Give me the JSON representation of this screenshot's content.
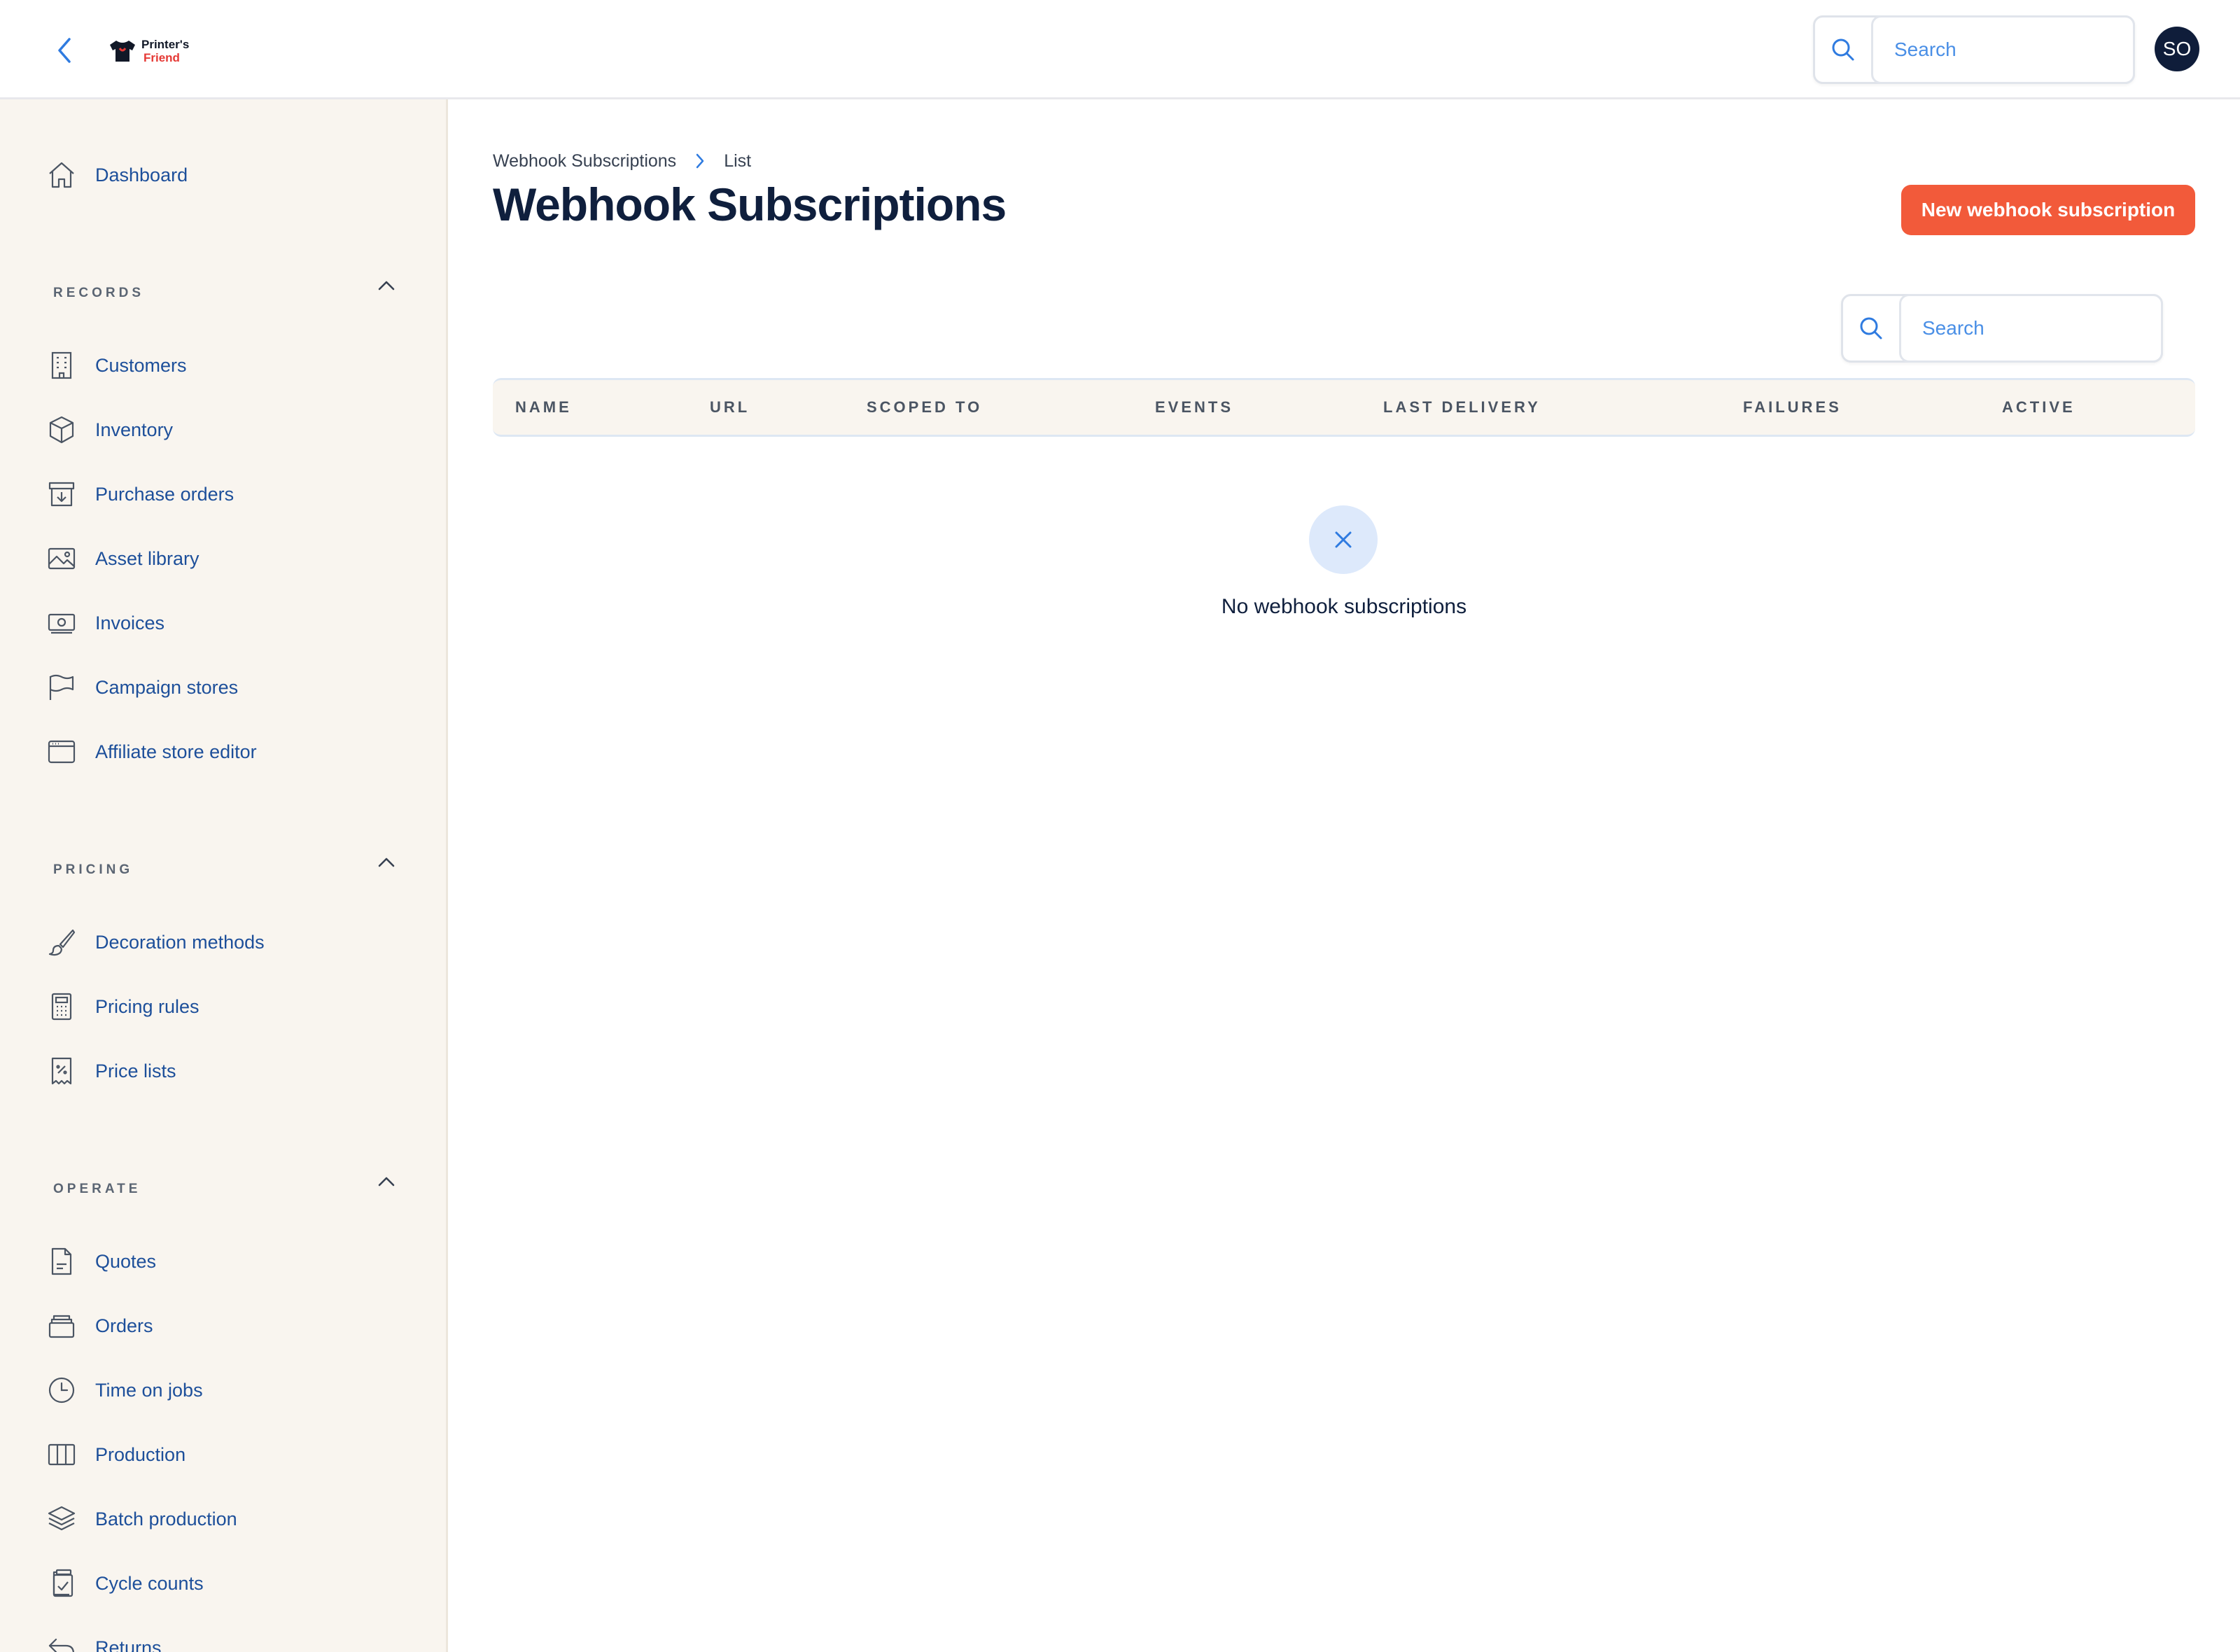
{
  "app": {
    "logo_line1": "Printer's",
    "logo_line2": "Friend",
    "search_placeholder": "Search",
    "avatar_initials": "SO"
  },
  "sidebar": {
    "dashboard": "Dashboard",
    "sections": [
      {
        "title": "RECORDS",
        "items": [
          {
            "label": "Customers",
            "icon": "building-icon"
          },
          {
            "label": "Inventory",
            "icon": "cube-icon"
          },
          {
            "label": "Purchase orders",
            "icon": "archive-in-icon"
          },
          {
            "label": "Asset library",
            "icon": "image-icon"
          },
          {
            "label": "Invoices",
            "icon": "money-icon"
          },
          {
            "label": "Campaign stores",
            "icon": "flag-icon"
          },
          {
            "label": "Affiliate store editor",
            "icon": "browser-window-icon"
          }
        ]
      },
      {
        "title": "PRICING",
        "items": [
          {
            "label": "Decoration methods",
            "icon": "paintbrush-icon"
          },
          {
            "label": "Pricing rules",
            "icon": "calculator-icon"
          },
          {
            "label": "Price lists",
            "icon": "receipt-percent-icon"
          }
        ]
      },
      {
        "title": "OPERATE",
        "items": [
          {
            "label": "Quotes",
            "icon": "document-icon"
          },
          {
            "label": "Orders",
            "icon": "stack-icon"
          },
          {
            "label": "Time on jobs",
            "icon": "clock-icon"
          },
          {
            "label": "Production",
            "icon": "columns-icon"
          },
          {
            "label": "Batch production",
            "icon": "layers-icon"
          },
          {
            "label": "Cycle counts",
            "icon": "clipboard-check-icon"
          },
          {
            "label": "Returns",
            "icon": "return-arrow-icon"
          }
        ]
      }
    ]
  },
  "main": {
    "breadcrumb": [
      "Webhook Subscriptions",
      "List"
    ],
    "title": "Webhook Subscriptions",
    "new_button": "New webhook subscription",
    "table_search_placeholder": "Search",
    "columns": [
      "NAME",
      "URL",
      "SCOPED TO",
      "EVENTS",
      "LAST DELIVERY",
      "FAILURES",
      "ACTIVE"
    ],
    "empty_message": "No webhook subscriptions"
  },
  "colors": {
    "accent": "#f25a3a",
    "nav_text": "#1d4f9a",
    "sidebar_bg": "#f9f5ef",
    "title": "#0f1f3d"
  }
}
